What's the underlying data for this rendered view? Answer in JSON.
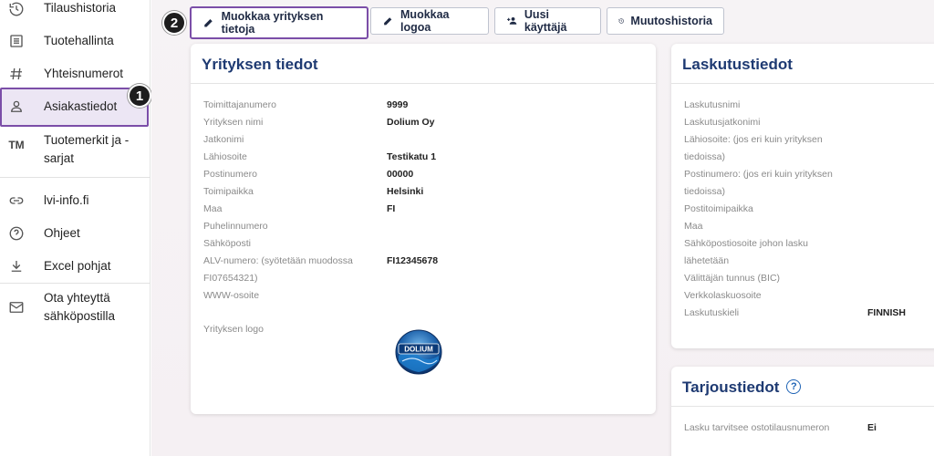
{
  "sidebar": {
    "items": [
      {
        "label": "Tilaushistoria",
        "icon": "history-icon"
      },
      {
        "label": "Tuotehallinta",
        "icon": "list-icon"
      },
      {
        "label": "Yhteisnumerot",
        "icon": "hash-icon"
      },
      {
        "label": "Asiakastiedot",
        "icon": "person-icon"
      },
      {
        "label": "Tuotemerkit ja -sarjat",
        "icon": "trademark-icon",
        "icon_text": "TM"
      },
      {
        "label": "lvi-info.fi",
        "icon": "link-icon"
      },
      {
        "label": "Ohjeet",
        "icon": "help-circle-icon"
      },
      {
        "label": "Excel pohjat",
        "icon": "download-icon"
      },
      {
        "label": "Ota yhteyttä sähköpostilla",
        "icon": "mail-icon"
      }
    ]
  },
  "steps": {
    "one": "1",
    "two": "2"
  },
  "toolbar": {
    "edit_company": "Muokkaa yrityksen tietoja",
    "edit_logo": "Muokkaa logoa",
    "new_user": "Uusi käyttäjä",
    "change_history": "Muutoshistoria"
  },
  "company": {
    "title": "Yrityksen tiedot",
    "rows": [
      {
        "label": "Toimittajanumero",
        "value": "9999"
      },
      {
        "label": "Yrityksen nimi",
        "value": "Dolium Oy"
      },
      {
        "label": "Jatkonimi",
        "value": ""
      },
      {
        "label": "Lähiosoite",
        "value": "Testikatu 1"
      },
      {
        "label": "Postinumero",
        "value": "00000"
      },
      {
        "label": "Toimipaikka",
        "value": "Helsinki"
      },
      {
        "label": "Maa",
        "value": "FI"
      },
      {
        "label": "Puhelinnumero",
        "value": ""
      },
      {
        "label": "Sähköposti",
        "value": ""
      },
      {
        "label": "ALV-numero: (syötetään muodossa",
        "label2": "FI07654321)",
        "value": "FI12345678"
      },
      {
        "label": "WWW-osoite",
        "value": ""
      }
    ],
    "logo_label": "Yrityksen logo",
    "logo_text": "DOLIUM"
  },
  "billing": {
    "title": "Laskutustiedot",
    "rows": [
      {
        "label": "Laskutusnimi",
        "value": ""
      },
      {
        "label": "Laskutusjatkonimi",
        "value": ""
      },
      {
        "label": "Lähiosoite: (jos eri kuin yrityksen",
        "label2": "tiedoissa)",
        "value": ""
      },
      {
        "label": "Postinumero: (jos eri kuin yrityksen",
        "label2": "tiedoissa)",
        "value": ""
      },
      {
        "label": "Postitoimipaikka",
        "value": ""
      },
      {
        "label": "Maa",
        "value": ""
      },
      {
        "label": "Sähköpostiosoite johon lasku",
        "label2": "lähetetään",
        "value": ""
      },
      {
        "label": "Välittäjän tunnus (BIC)",
        "value": ""
      },
      {
        "label": "Verkkolaskuosoite",
        "value": ""
      },
      {
        "label": "Laskutuskieli",
        "value": "FINNISH"
      }
    ]
  },
  "offer": {
    "title": "Tarjoustiedot",
    "rows": [
      {
        "label": "Lasku tarvitsee ostotilausnumeron",
        "value": "Ei"
      }
    ]
  },
  "colors": {
    "accent": "#7b4ea8",
    "title_blue": "#1e3a72",
    "help_blue": "#1e63b5"
  }
}
